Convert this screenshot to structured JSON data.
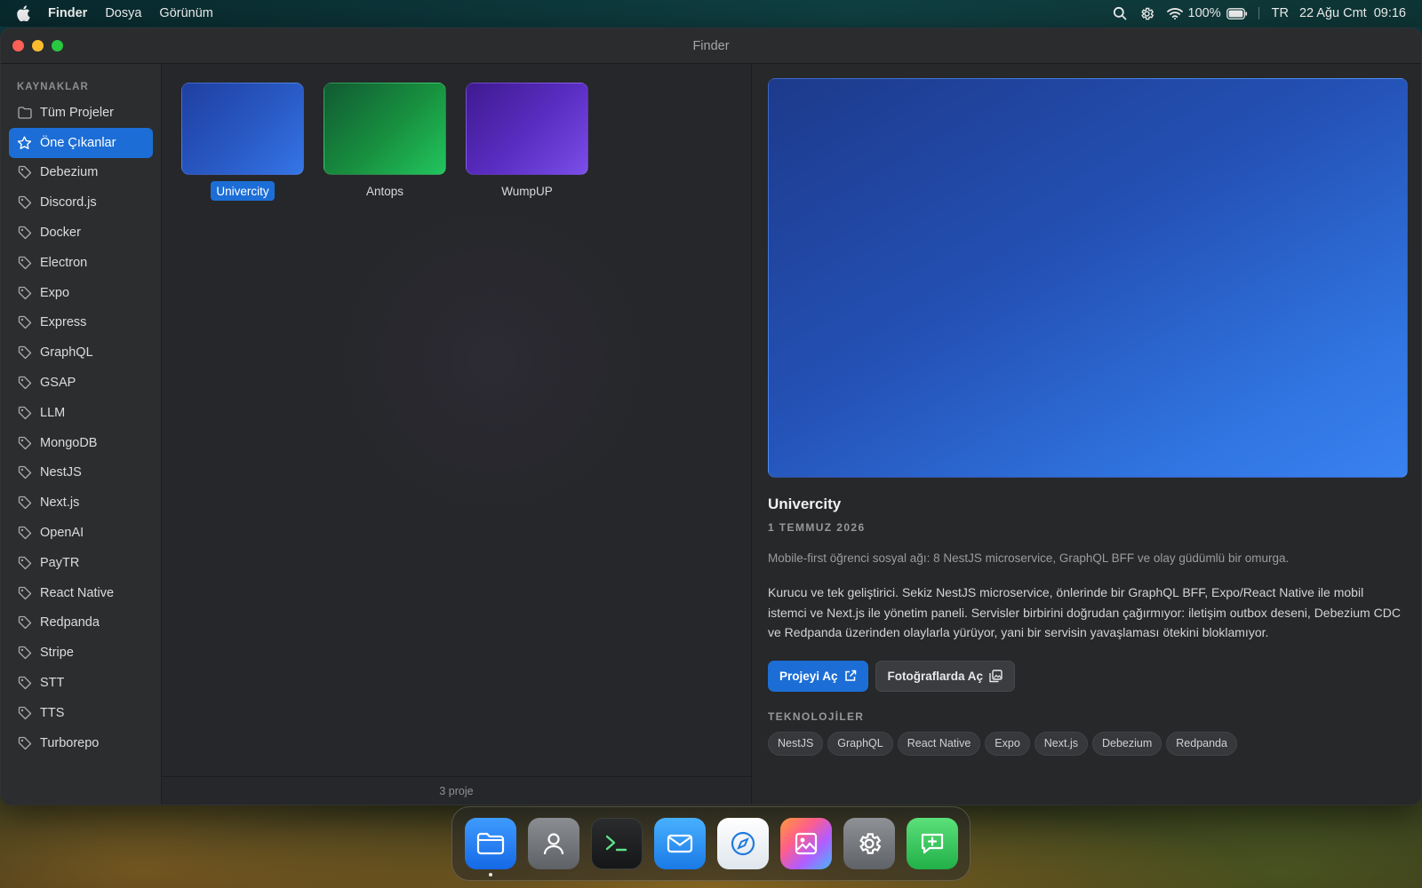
{
  "menubar": {
    "app_name": "Finder",
    "menus": [
      "Dosya",
      "Görünüm"
    ],
    "battery": "100%",
    "input_source": "TR",
    "date": "22 Ağu Cmt",
    "time": "09:16"
  },
  "window": {
    "title": "Finder"
  },
  "sidebar": {
    "heading": "KAYNAKLAR",
    "items": [
      {
        "label": "Tüm Projeler",
        "icon": "folder-icon"
      },
      {
        "label": "Öne Çıkanlar",
        "icon": "star-icon",
        "active": true
      },
      {
        "label": "Debezium",
        "icon": "tag-icon"
      },
      {
        "label": "Discord.js",
        "icon": "tag-icon"
      },
      {
        "label": "Docker",
        "icon": "tag-icon"
      },
      {
        "label": "Electron",
        "icon": "tag-icon"
      },
      {
        "label": "Expo",
        "icon": "tag-icon"
      },
      {
        "label": "Express",
        "icon": "tag-icon"
      },
      {
        "label": "GraphQL",
        "icon": "tag-icon"
      },
      {
        "label": "GSAP",
        "icon": "tag-icon"
      },
      {
        "label": "LLM",
        "icon": "tag-icon"
      },
      {
        "label": "MongoDB",
        "icon": "tag-icon"
      },
      {
        "label": "NestJS",
        "icon": "tag-icon"
      },
      {
        "label": "Next.js",
        "icon": "tag-icon"
      },
      {
        "label": "OpenAI",
        "icon": "tag-icon"
      },
      {
        "label": "PayTR",
        "icon": "tag-icon"
      },
      {
        "label": "React Native",
        "icon": "tag-icon"
      },
      {
        "label": "Redpanda",
        "icon": "tag-icon"
      },
      {
        "label": "Stripe",
        "icon": "tag-icon"
      },
      {
        "label": "STT",
        "icon": "tag-icon"
      },
      {
        "label": "TTS",
        "icon": "tag-icon"
      },
      {
        "label": "Turborepo",
        "icon": "tag-icon"
      }
    ]
  },
  "projects": {
    "items": [
      {
        "name": "Univercity",
        "color": "#2a5cc8",
        "selected": true
      },
      {
        "name": "Antops",
        "color": "#18913f"
      },
      {
        "name": "WumpUP",
        "color": "#5b2ec4"
      }
    ],
    "count_label": "3 proje"
  },
  "detail": {
    "title": "Univercity",
    "date": "1 TEMMUZ 2026",
    "summary": "Mobile-first öğrenci sosyal ağı: 8 NestJS microservice, GraphQL BFF ve olay güdümlü bir omurga.",
    "description": "Kurucu ve tek geliştirici. Sekiz NestJS microservice, önlerinde bir GraphQL BFF, Expo/React Native ile mobil istemci ve Next.js ile yönetim paneli. Servisler birbirini doğrudan çağırmıyor: iletişim outbox deseni, Debezium CDC ve Redpanda üzerinden olaylarla yürüyor, yani bir servisin yavaşlaması ötekini bloklamıyor.",
    "open_button": "Projeyi Aç",
    "photos_button": "Fotoğraflarda Aç",
    "tech_heading": "TEKNOLOJİLER",
    "tags": [
      "NestJS",
      "GraphQL",
      "React Native",
      "Expo",
      "Next.js",
      "Debezium",
      "Redpanda"
    ]
  },
  "dock": {
    "items": [
      "finder-icon",
      "contacts-icon",
      "terminal-icon",
      "mail-icon",
      "safari-icon",
      "photos-icon",
      "settings-icon",
      "messages-icon"
    ]
  },
  "colors": {
    "accent": "#1c6ed6"
  }
}
